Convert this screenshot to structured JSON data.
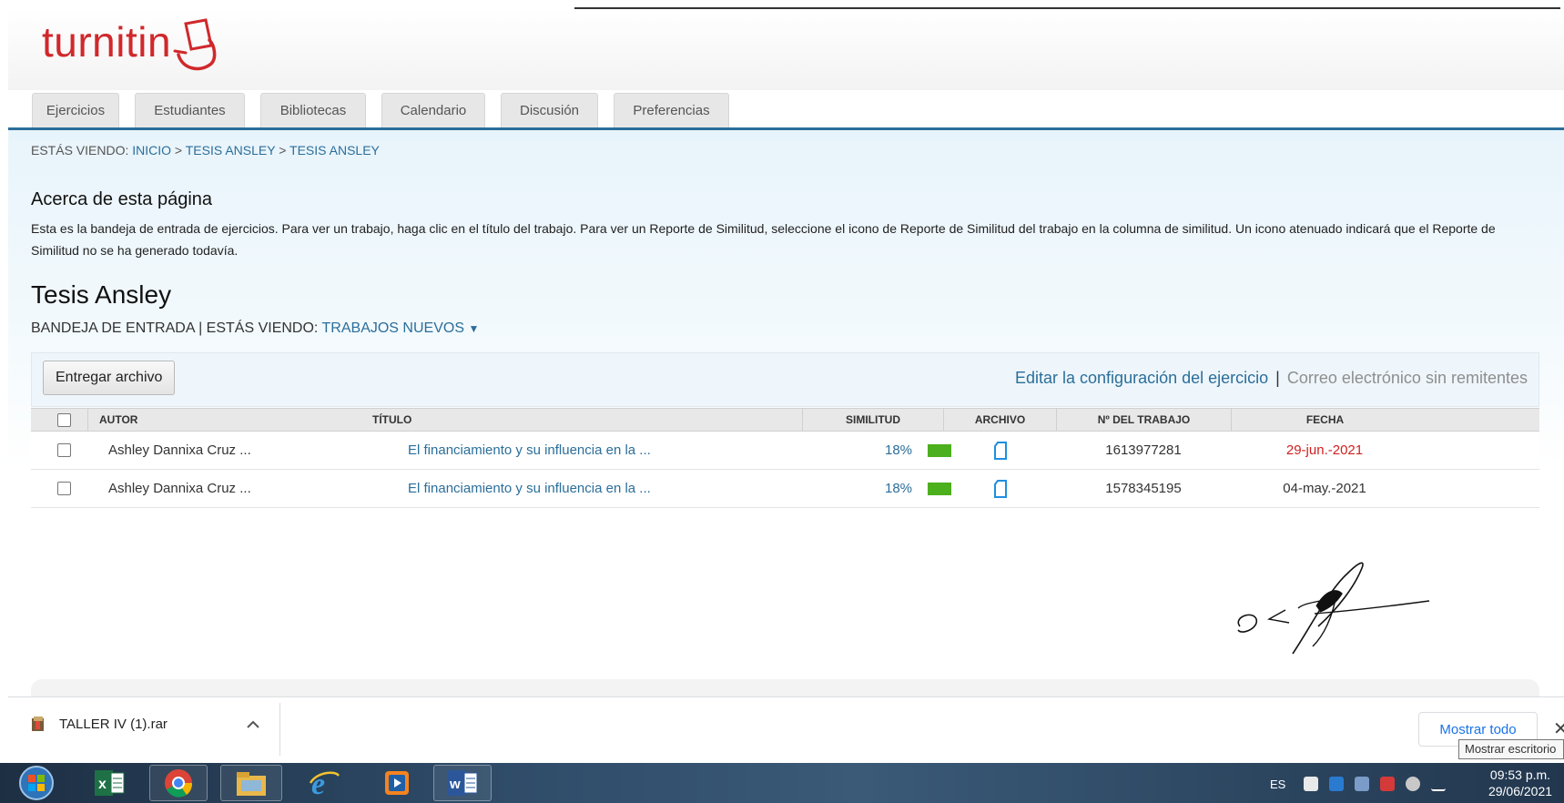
{
  "app": {
    "logo_text": "turnitin"
  },
  "tabs": [
    {
      "label": "Ejercicios"
    },
    {
      "label": "Estudiantes"
    },
    {
      "label": "Bibliotecas"
    },
    {
      "label": "Calendario"
    },
    {
      "label": "Discusión"
    },
    {
      "label": "Preferencias"
    }
  ],
  "breadcrumb": {
    "prefix": "ESTÁS VIENDO:",
    "items": [
      "INICIO",
      "TESIS ANSLEY",
      "TESIS ANSLEY"
    ],
    "separator": ">"
  },
  "about": {
    "title": "Acerca de esta página",
    "text": "Esta es la bandeja de entrada de ejercicios. Para ver un trabajo, haga clic en el título del trabajo. Para ver un Reporte de Similitud, seleccione el icono de Reporte de Similitud del trabajo en la columna de similitud. Un icono atenuado indicará que el Reporte de Similitud no se ha generado todavía."
  },
  "assignment": {
    "title": "Tesis Ansley",
    "inbox_label": "BANDEJA DE ENTRADA",
    "viewing_label": "| ESTÁS VIENDO:",
    "viewing_value": "TRABAJOS NUEVOS",
    "viewing_caret": "▼"
  },
  "toolbar": {
    "submit_label": "Entregar archivo",
    "edit_settings": "Editar la configuración del ejercicio",
    "separator": "|",
    "email_non_submitters": "Correo electrónico sin remitentes"
  },
  "table": {
    "headers": {
      "author": "AUTOR",
      "title": "TÍTULO",
      "similarity": "SIMILITUD",
      "file": "ARCHIVO",
      "paper_id": "Nº DEL TRABAJO",
      "date": "FECHA"
    },
    "rows": [
      {
        "author": "Ashley Dannixa Cruz ...",
        "title": "El financiamiento y su influencia en la ...",
        "similarity": "18%",
        "paper_id": "1613977281",
        "date": "29-jun.-2021",
        "date_late": true
      },
      {
        "author": "Ashley Dannixa Cruz ...",
        "title": "El financiamiento y su influencia en la ...",
        "similarity": "18%",
        "paper_id": "1578345195",
        "date": "04-may.-2021",
        "date_late": false
      }
    ]
  },
  "colors": {
    "brand_red": "#d0282c",
    "link_blue": "#2b6e9a",
    "similarity_green": "#4caf1d",
    "late_red": "#d02020"
  },
  "download_bar": {
    "file_name": "TALLER IV (1).rar",
    "show_all": "Mostrar todo",
    "close": "✕",
    "tooltip": "Mostrar escritorio"
  },
  "taskbar": {
    "apps": [
      "start-orb-icon",
      "excel-icon",
      "chrome-icon",
      "file-explorer-icon",
      "internet-explorer-icon",
      "media-player-icon",
      "word-icon"
    ],
    "language": "ES",
    "time": "09:53 p.m.",
    "date": "29/06/2021"
  }
}
